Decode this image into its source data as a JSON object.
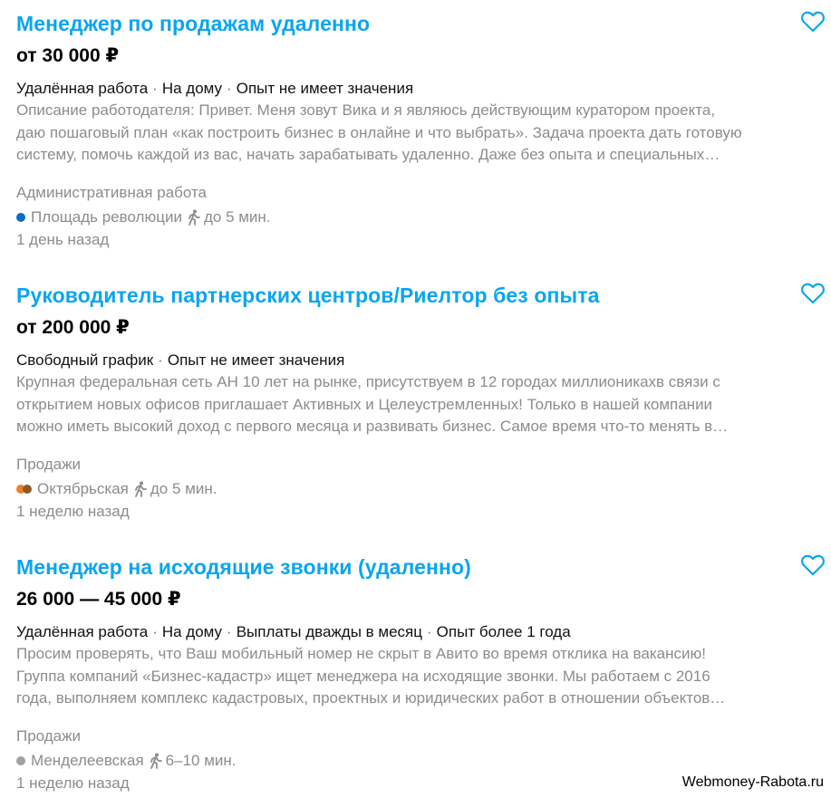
{
  "vacancies": [
    {
      "title": "Менеджер по продажам удаленно",
      "salary": "от 30 000 ₽",
      "tags": [
        "Удалённая работа",
        "На дому",
        "Опыт не имеет значения"
      ],
      "description_lines": [
        "Описание работодателя: Привет. Меня зовут Вика и я являюсь действующим куратором проекта,",
        "даю пошаговый план «как построить бизнес в онлайне и что выбрать». Задача проекта дать готовую",
        "систему, помочь каждой из вас, начать зарабатывать удаленно. Даже без опыта и специальных…"
      ],
      "category": "Административная работа",
      "metro": {
        "station": "Площадь революции",
        "walk": "до 5 мин.",
        "colors": [
          "#0a6fc2"
        ]
      },
      "date": "1 день назад"
    },
    {
      "title": "Руководитель партнерских центров/Риелтор без опыта",
      "salary": "от 200 000 ₽",
      "tags": [
        "Свободный график",
        "Опыт не имеет значения"
      ],
      "description_lines": [
        "Крупная федеральная сеть АН 10 лет на рынке, присутствуем в 12 городах миллионикахв связи с",
        "открытием новых офисов приглашает Активных и Целеустремленных! Только в нашей компании",
        "можно иметь высокий доход с первого месяца и развивать бизнес. Самое время что-то менять в…"
      ],
      "category": "Продажи",
      "metro": {
        "station": "Октябрьская",
        "walk": "до 5 мин.",
        "colors": [
          "#f07e25",
          "#8b5a2b"
        ]
      },
      "date": "1 неделю назад"
    },
    {
      "title": "Менеджер на исходящие звонки (удаленно)",
      "salary": "26 000 — 45 000 ₽",
      "tags": [
        "Удалённая работа",
        "На дому",
        "Выплаты дважды в месяц",
        "Опыт более 1 года"
      ],
      "description_lines": [
        "Просим проверять, что Ваш мобильный номер не скрыт в Авито во время отклика на вакансию!",
        "Группа компаний «Бизнес-кадастр» ищет менеджера на исходящие звонки. Мы работаем с 2016",
        "года, выполняем комплекс кадастровых, проектных и юридических работ в отношении объектов…"
      ],
      "category": "Продажи",
      "metro": {
        "station": "Менделеевская",
        "walk": "6–10 мин.",
        "colors": [
          "#a0a0a0"
        ]
      },
      "date": "1 неделю назад"
    }
  ],
  "watermark": "Webmoney-Rabota.ru",
  "icons": {
    "favorite": "heart-outline-icon",
    "walk": "walking-person-icon",
    "metro": "metro-line-dot-icon"
  },
  "colors": {
    "title": "#0aa5f0",
    "muted": "#8c8c8c",
    "heart": "#0aa5f0"
  }
}
